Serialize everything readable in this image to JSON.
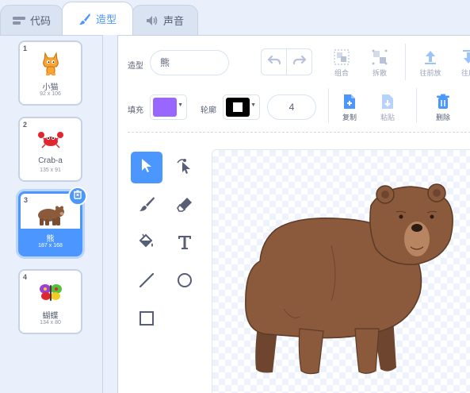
{
  "tabs": [
    {
      "label": "代码",
      "icon": "code-icon"
    },
    {
      "label": "造型",
      "icon": "brush-icon"
    },
    {
      "label": "声音",
      "icon": "speaker-icon"
    }
  ],
  "costumes": [
    {
      "index": "1",
      "name": "小猫",
      "size": "92 x 106",
      "thumb": "cat-icon"
    },
    {
      "index": "2",
      "name": "Crab-a",
      "size": "135 x 91",
      "thumb": "crab-icon"
    },
    {
      "index": "3",
      "name": "熊",
      "size": "187 x 168",
      "thumb": "bear-icon",
      "selected": true
    },
    {
      "index": "4",
      "name": "蝴蝶",
      "size": "134 x 80",
      "thumb": "butterfly-icon"
    }
  ],
  "editor": {
    "costume_label": "造型",
    "costume_name": "熊",
    "fill_label": "填充",
    "outline_label": "轮廓",
    "stroke_width": "4",
    "fill_color": "#9966ff",
    "outline_color": "#000000",
    "group_label": "组合",
    "ungroup_label": "拆散",
    "forward_label": "往前放",
    "backward_label": "往后",
    "copy_label": "复制",
    "paste_label": "粘贴",
    "delete_label": "删除"
  },
  "tools": [
    "select-icon",
    "reshape-icon",
    "brush-icon",
    "eraser-icon",
    "fill-icon",
    "text-icon",
    "line-icon",
    "circle-icon",
    "rectangle-icon"
  ],
  "colors": {
    "accent": "#4c97ff",
    "text": "#575e75",
    "panel": "#e9f0fc"
  }
}
